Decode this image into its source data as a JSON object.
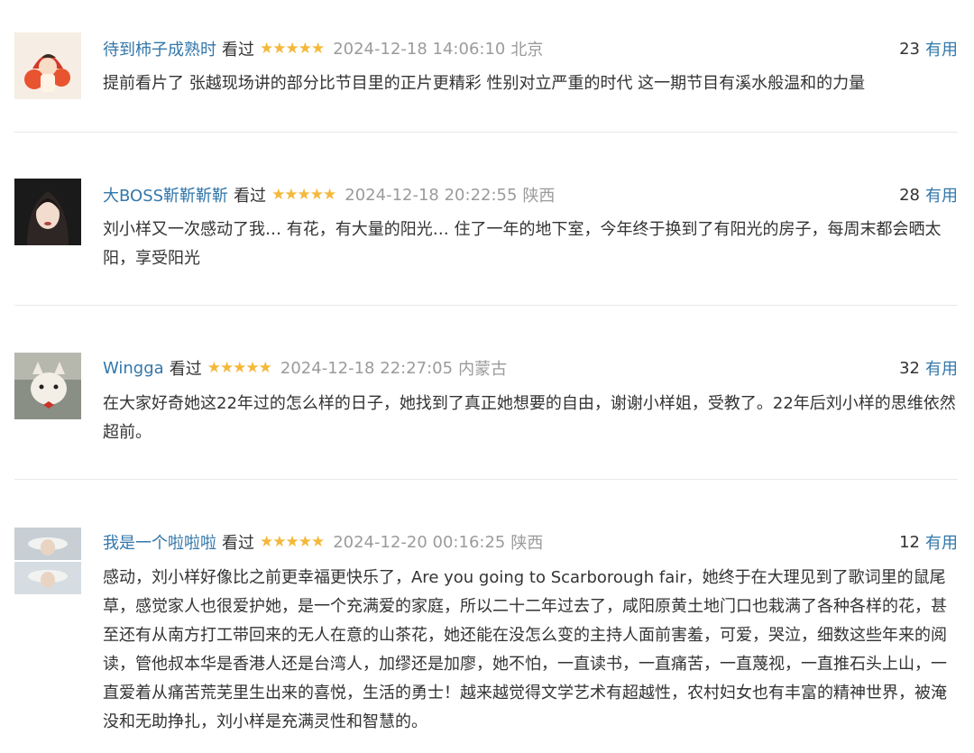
{
  "colors": {
    "link": "#3377aa",
    "star": "#f4b83a",
    "meta": "#9b9b9b",
    "divider": "#e8e8e8"
  },
  "reviews": [
    {
      "author": "待到柿子成熟时",
      "status": "看过",
      "rating": 5,
      "stars": "★★★★★",
      "time": "2024-12-18 14:06:10",
      "location": "北京",
      "votes": "23",
      "useful_label": "有用",
      "content": "提前看片了 张越现场讲的部分比节目里的正片更精彩 性别对立严重的时代 这一期节目有溪水般温和的力量"
    },
    {
      "author": "大BOSS靳靳靳靳",
      "status": "看过",
      "rating": 5,
      "stars": "★★★★★",
      "time": "2024-12-18 20:22:55",
      "location": "陕西",
      "votes": "28",
      "useful_label": "有用",
      "content": "刘小样又一次感动了我… 有花，有大量的阳光… 住了一年的地下室，今年终于换到了有阳光的房子，每周末都会晒太阳，享受阳光"
    },
    {
      "author": "Wingga",
      "status": "看过",
      "rating": 5,
      "stars": "★★★★★",
      "time": "2024-12-18 22:27:05",
      "location": "内蒙古",
      "votes": "32",
      "useful_label": "有用",
      "content": "在大家好奇她这22年过的怎么样的日子，她找到了真正她想要的自由，谢谢小样姐，受教了。22年后刘小样的思维依然超前。"
    },
    {
      "author": "我是一个啦啦啦",
      "status": "看过",
      "rating": 5,
      "stars": "★★★★★",
      "time": "2024-12-20 00:16:25",
      "location": "陕西",
      "votes": "12",
      "useful_label": "有用",
      "content": "感动，刘小样好像比之前更幸福更快乐了，Are you going to Scarborough fair，她终于在大理见到了歌词里的鼠尾草，感觉家人也很爱护她，是一个充满爱的家庭，所以二十二年过去了，咸阳原黄土地门口也栽满了各种各样的花，甚至还有从南方打工带回来的无人在意的山茶花，她还能在没怎么变的主持人面前害羞，可爱，哭泣，细数这些年来的阅读，管他叔本华是香港人还是台湾人，加缪还是加廖，她不怕，一直读书，一直痛苦，一直蔑视，一直推石头上山，一直爱着从痛苦荒芜里生出来的喜悦，生活的勇士！越来越觉得文学艺术有超越性，农村妇女也有丰富的精神世界，被淹没和无助挣扎，刘小样是充满灵性和智慧的。"
    }
  ]
}
